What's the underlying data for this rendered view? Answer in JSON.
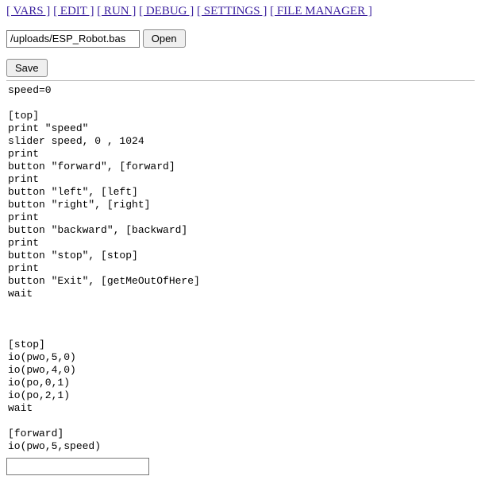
{
  "nav": {
    "vars": "[ VARS ]",
    "edit": "[ EDIT ]",
    "run": "[ RUN ]",
    "debug": "[ DEBUG ]",
    "settings": "[ SETTINGS ]",
    "filemgr": "[ FILE MANAGER ]"
  },
  "file": {
    "path": "/uploads/ESP_Robot.bas",
    "open_label": "Open"
  },
  "save": {
    "label": "Save"
  },
  "code": {
    "text": "speed=0\n\n[top]\nprint \"speed\"\nslider speed, 0 , 1024\nprint\nbutton \"forward\", [forward]\nprint\nbutton \"left\", [left]\nbutton \"right\", [right]\nprint\nbutton \"backward\", [backward]\nprint\nbutton \"stop\", [stop]\nprint\nbutton \"Exit\", [getMeOutOfHere]\nwait\n\n\n\n[stop]\nio(pwo,5,0)\nio(pwo,4,0)\nio(po,0,1)\nio(po,2,1)\nwait\n\n[forward]\nio(pwo,5,speed)"
  },
  "bottom_input": {
    "value": ""
  }
}
